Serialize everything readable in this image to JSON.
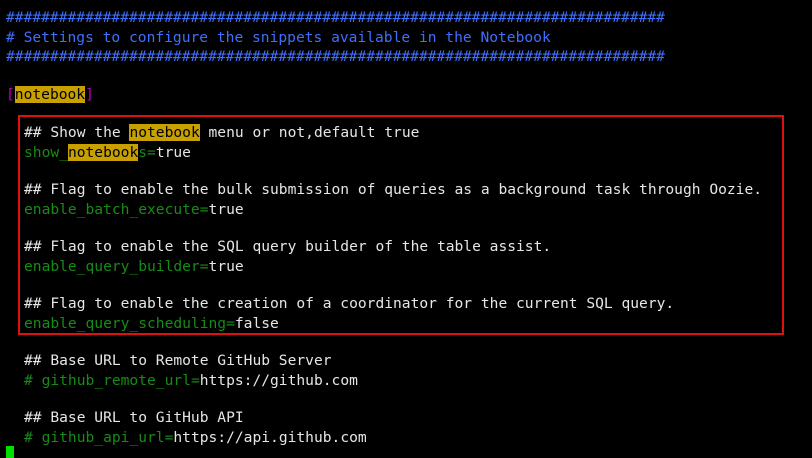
{
  "header": {
    "rule_top": "###########################################################################",
    "title_comment": "# Settings to configure the snippets available in the Notebook",
    "rule_bottom": "###########################################################################"
  },
  "section": {
    "bracket_open": "[",
    "name": "notebook",
    "bracket_close": "]"
  },
  "settings": {
    "show_notebooks": {
      "comment_before": "## Show the ",
      "comment_highlight": "notebook",
      "comment_after": " menu or not,default true",
      "key_prefix": "show_",
      "key_highlight": "notebook",
      "key_suffix": "s",
      "equals": "=",
      "value": "true"
    },
    "enable_batch_execute": {
      "comment": "## Flag to enable the bulk submission of queries as a background task through Oozie.",
      "key": "enable_batch_execute",
      "equals": "=",
      "value": "true"
    },
    "enable_query_builder": {
      "comment": "## Flag to enable the SQL query builder of the table assist.",
      "key": "enable_query_builder",
      "equals": "=",
      "value": "true"
    },
    "enable_query_scheduling": {
      "comment": "## Flag to enable the creation of a coordinator for the current SQL query.",
      "key": "enable_query_scheduling",
      "equals": "=",
      "value": "false"
    },
    "github_remote_url": {
      "comment": "## Base URL to Remote GitHub Server",
      "key": "# github_remote_url",
      "equals": "=",
      "value": "https://github.com"
    },
    "github_api_url": {
      "comment": "## Base URL to GitHub API",
      "key": "# github_api_url",
      "equals": "=",
      "value": "https://api.github.com"
    }
  },
  "colors": {
    "comment_blue": "#3f6fff",
    "key_green": "#168c16",
    "bracket_magenta": "#c000c0",
    "highlight_yellow": "#c8a000",
    "annotation_red": "#e01010",
    "cursor_green": "#00e000"
  }
}
